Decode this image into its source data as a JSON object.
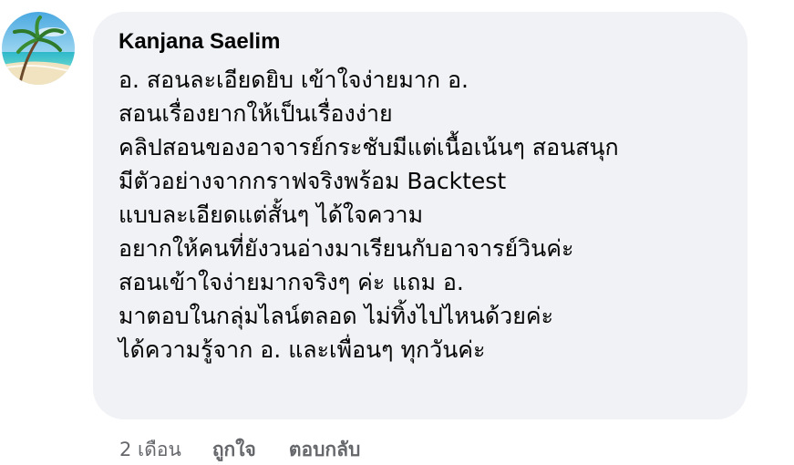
{
  "comment": {
    "author": "Kanjana Saelim",
    "avatar": "beach-palm-avatar",
    "lines": [
      "อ. สอนละเอียดยิบ เข้าใจง่ายมาก อ.",
      "สอนเรื่องยากให้เป็นเรื่องง่าย",
      "คลิปสอนของอาจารย์กระชับมีแต่เนื้อเน้นๆ สอนสนุก",
      "มีตัวอย่างจากกราฟจริงพร้อม Backtest",
      "แบบละเอียดแต่สั้นๆ ได้ใจความ",
      "อยากให้คนที่ยังวนอ่างมาเรียนกับอาจารย์วินค่ะ",
      "สอนเข้าใจง่ายมากจริงๆ ค่ะ แถม อ.",
      "มาตอบในกลุ่มไลน์ตลอด ไม่ทิ้งไปไหนด้วยค่ะ",
      "ได้ความรู้จาก อ. และเพื่อนๆ ทุกวันค่ะ"
    ],
    "timestamp": "2 เดือน",
    "like_label": "ถูกใจ",
    "reply_label": "ตอบกลับ"
  },
  "colors": {
    "bubble_bg": "#f0f2f5",
    "text": "#050505",
    "secondary_text": "#65676b"
  }
}
